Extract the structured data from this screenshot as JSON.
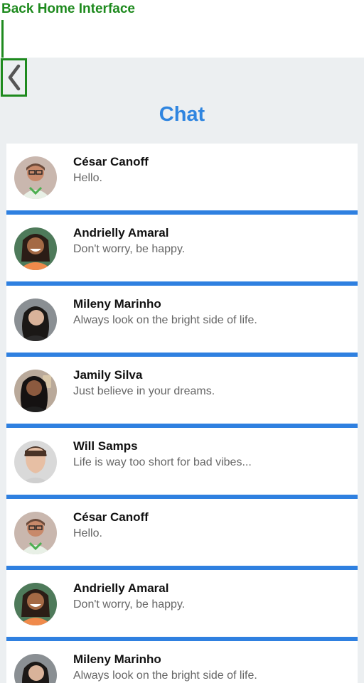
{
  "annotation": {
    "label": "Back Home Interface",
    "color": "#1e8a1e"
  },
  "header": {
    "title": "Chat",
    "title_color": "#2f85e0",
    "back_icon": "chevron-left-icon"
  },
  "colors": {
    "background": "#eceff1",
    "separator": "#2f80e0",
    "card": "#ffffff"
  },
  "chats": [
    {
      "name": "César Canoff",
      "message": "Hello.",
      "avatar": "photo-cesar"
    },
    {
      "name": "Andrielly Amaral",
      "message": "Don't worry, be happy.",
      "avatar": "photo-andrielly"
    },
    {
      "name": "Mileny Marinho",
      "message": "Always look on the bright side of life.",
      "avatar": "photo-mileny"
    },
    {
      "name": "Jamily Silva",
      "message": "Just believe in your dreams.",
      "avatar": "photo-jamily"
    },
    {
      "name": "Will Samps",
      "message": "Life is way too short for bad vibes...",
      "avatar": "photo-will"
    },
    {
      "name": "César Canoff",
      "message": "Hello.",
      "avatar": "photo-cesar"
    },
    {
      "name": "Andrielly Amaral",
      "message": "Don't worry, be happy.",
      "avatar": "photo-andrielly"
    },
    {
      "name": "Mileny Marinho",
      "message": "Always look on the bright side of life.",
      "avatar": "photo-mileny"
    }
  ]
}
